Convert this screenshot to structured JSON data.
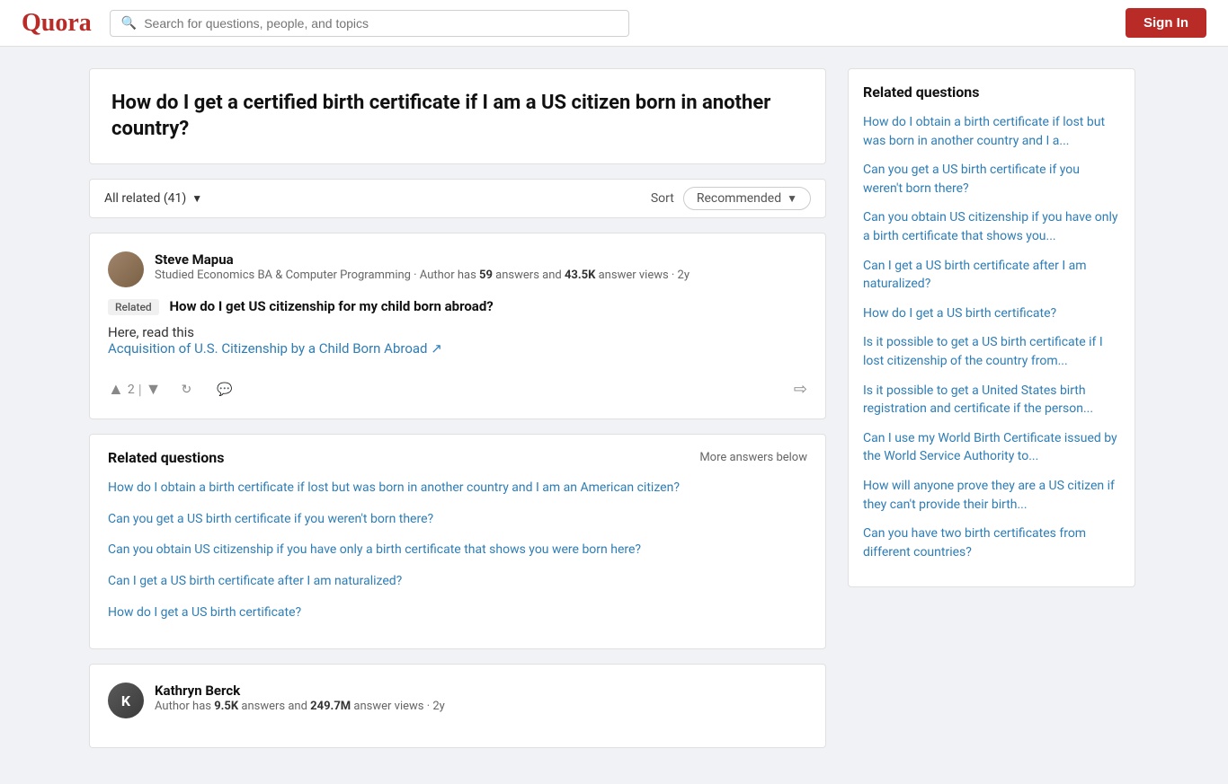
{
  "header": {
    "logo": "Quora",
    "search_placeholder": "Search for questions, people, and topics",
    "sign_in_label": "Sign In"
  },
  "question": {
    "title": "How do I get a certified birth certificate if I am a US citizen born in another country?"
  },
  "filter_bar": {
    "all_related_label": "All related (41)",
    "sort_label": "Sort",
    "sort_value": "Recommended"
  },
  "answer": {
    "author_name": "Steve Mapua",
    "author_bio": "Studied Economics BA & Computer Programming · Author has",
    "author_bold1": "59",
    "author_bio2": "answers and",
    "author_bold2": "43.5K",
    "author_bio3": "answer views ·",
    "author_time": "2y",
    "related_badge": "Related",
    "related_question": "How do I get US citizenship for my child born abroad?",
    "answer_body": "Here, read this",
    "answer_link_text": "Acquisition of U.S. Citizenship by a Child Born Abroad",
    "answer_link_icon": "↗",
    "upvote_count": "2"
  },
  "related_questions_block": {
    "title": "Related questions",
    "more_answers": "More answers below",
    "items": [
      "How do I obtain a birth certificate if lost but was born in another country and I am an American citizen?",
      "Can you get a US birth certificate if you weren't born there?",
      "Can you obtain US citizenship if you have only a birth certificate that shows you were born here?",
      "Can I get a US birth certificate after I am naturalized?",
      "How do I get a US birth certificate?"
    ]
  },
  "second_answer": {
    "author_name": "Kathryn Berck",
    "author_bio_parts": [
      "Author has",
      "9.5K",
      "answers and",
      "249.7M",
      "answer views · 2y"
    ]
  },
  "sidebar": {
    "title": "Related questions",
    "items": [
      "How do I obtain a birth certificate if lost but was born in another country and I a...",
      "Can you get a US birth certificate if you weren't born there?",
      "Can you obtain US citizenship if you have only a birth certificate that shows you...",
      "Can I get a US birth certificate after I am naturalized?",
      "How do I get a US birth certificate?",
      "Is it possible to get a US birth certificate if I lost citizenship of the country from...",
      "Is it possible to get a United States birth registration and certificate if the person...",
      "Can I use my World Birth Certificate issued by the World Service Authority to...",
      "How will anyone prove they are a US citizen if they can't provide their birth...",
      "Can you have two birth certificates from different countries?"
    ]
  }
}
